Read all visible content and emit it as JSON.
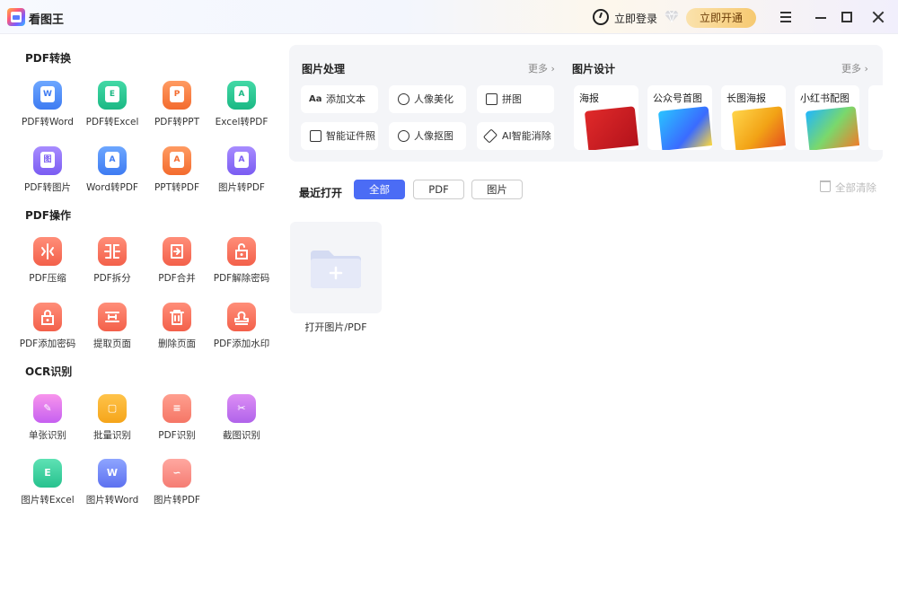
{
  "app": {
    "title": "看图王",
    "login": "立即登录",
    "open_vip": "立即开通"
  },
  "sections": {
    "convert": {
      "title": "PDF转换",
      "tools": [
        "PDF转Word",
        "PDF转Excel",
        "PDF转PPT",
        "Excel转PDF",
        "PDF转图片",
        "Word转PDF",
        "PPT转PDF",
        "图片转PDF"
      ],
      "glyphs": [
        "W",
        "E",
        "P",
        "A",
        "图",
        "A",
        "A",
        "A"
      ]
    },
    "ops": {
      "title": "PDF操作",
      "tools": [
        "PDF压缩",
        "PDF拆分",
        "PDF合并",
        "PDF解除密码",
        "PDF添加密码",
        "提取页面",
        "删除页面",
        "PDF添加水印"
      ]
    },
    "ocr": {
      "title": "OCR识别",
      "tools": [
        "单张识别",
        "批量识别",
        "PDF识别",
        "截图识别",
        "图片转Excel",
        "图片转Word",
        "图片转PDF"
      ],
      "glyphs": [
        "✎",
        "▢",
        "≡",
        "✂",
        "E",
        "W",
        "∽"
      ]
    }
  },
  "image_processing": {
    "title": "图片处理",
    "more": "更多",
    "items": [
      "添加文本",
      "人像美化",
      "拼图",
      "智能证件照",
      "人像抠图",
      "AI智能消除"
    ]
  },
  "image_design": {
    "title": "图片设计",
    "more": "更多",
    "items": [
      "海报",
      "公众号首图",
      "长图海报",
      "小红书配图"
    ]
  },
  "recent": {
    "title": "最近打开",
    "tabs": [
      "全部",
      "PDF",
      "图片"
    ],
    "clear_all": "全部清除",
    "open_label": "打开图片/PDF"
  },
  "colors": {
    "accent": "#4b6cf5",
    "vip_gold": "#f6c971"
  }
}
